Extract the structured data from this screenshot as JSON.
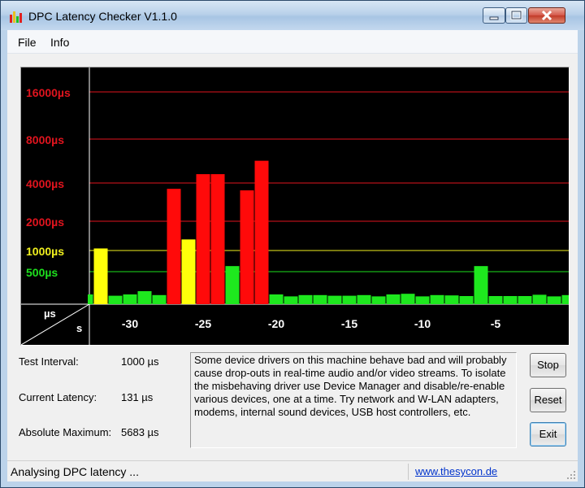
{
  "window": {
    "title": "DPC Latency Checker V1.1.0"
  },
  "menu": [
    "File",
    "Info"
  ],
  "graph": {
    "corner_top": "µs",
    "corner_bottom": "s",
    "y_labels": [
      {
        "text": "16000µs",
        "value": 16000,
        "color": "#e0141e"
      },
      {
        "text": "8000µs",
        "value": 8000,
        "color": "#e0141e"
      },
      {
        "text": "4000µs",
        "value": 4000,
        "color": "#e0141e"
      },
      {
        "text": "2000µs",
        "value": 2000,
        "color": "#e0141e"
      },
      {
        "text": "1000µs",
        "value": 1000,
        "color": "#f0f01e"
      },
      {
        "text": "500µs",
        "value": 500,
        "color": "#1ee01e"
      }
    ],
    "x_labels": [
      "-30",
      "-25",
      "-20",
      "-15",
      "-10",
      "-5"
    ],
    "bars": [
      {
        "t": -33,
        "us": 150
      },
      {
        "t": -32,
        "us": 1050
      },
      {
        "t": -31,
        "us": 130
      },
      {
        "t": -30,
        "us": 150
      },
      {
        "t": -29,
        "us": 200
      },
      {
        "t": -28,
        "us": 140
      },
      {
        "t": -27,
        "us": 3600
      },
      {
        "t": -26,
        "us": 1300
      },
      {
        "t": -25,
        "us": 4600
      },
      {
        "t": -24,
        "us": 4600
      },
      {
        "t": -23,
        "us": 600
      },
      {
        "t": -22,
        "us": 3500
      },
      {
        "t": -21,
        "us": 5683
      },
      {
        "t": -20,
        "us": 150
      },
      {
        "t": -19,
        "us": 120
      },
      {
        "t": -18,
        "us": 140
      },
      {
        "t": -17,
        "us": 140
      },
      {
        "t": -16,
        "us": 130
      },
      {
        "t": -15,
        "us": 130
      },
      {
        "t": -14,
        "us": 140
      },
      {
        "t": -13,
        "us": 120
      },
      {
        "t": -12,
        "us": 150
      },
      {
        "t": -11,
        "us": 160
      },
      {
        "t": -10,
        "us": 120
      },
      {
        "t": -9,
        "us": 140
      },
      {
        "t": -8,
        "us": 135
      },
      {
        "t": -7,
        "us": 125
      },
      {
        "t": -6,
        "us": 600
      },
      {
        "t": -5,
        "us": 125
      },
      {
        "t": -4,
        "us": 125
      },
      {
        "t": -3,
        "us": 125
      },
      {
        "t": -2,
        "us": 145
      },
      {
        "t": -1,
        "us": 120
      },
      {
        "t": 0,
        "us": 140
      }
    ],
    "colors": {
      "red": "#ff0a0a",
      "yellow": "#ffff0a",
      "green": "#1ee81e",
      "background": "#000000"
    }
  },
  "stats": {
    "interval_label": "Test Interval:",
    "interval_value": "1000 µs",
    "current_label": "Current Latency:",
    "current_value": "131 µs",
    "max_label": "Absolute Maximum:",
    "max_value": "5683 µs"
  },
  "message": "Some device drivers on this machine behave bad and will probably cause drop-outs in real-time audio and/or video streams. To isolate the misbehaving driver use Device Manager and disable/re-enable various devices, one at a time. Try network and W-LAN adapters, modems, internal sound devices, USB host controllers, etc.",
  "buttons": {
    "stop": "Stop",
    "reset": "Reset",
    "exit": "Exit"
  },
  "status": {
    "text": "Analysing DPC latency ...",
    "link": "www.thesycon.de"
  }
}
